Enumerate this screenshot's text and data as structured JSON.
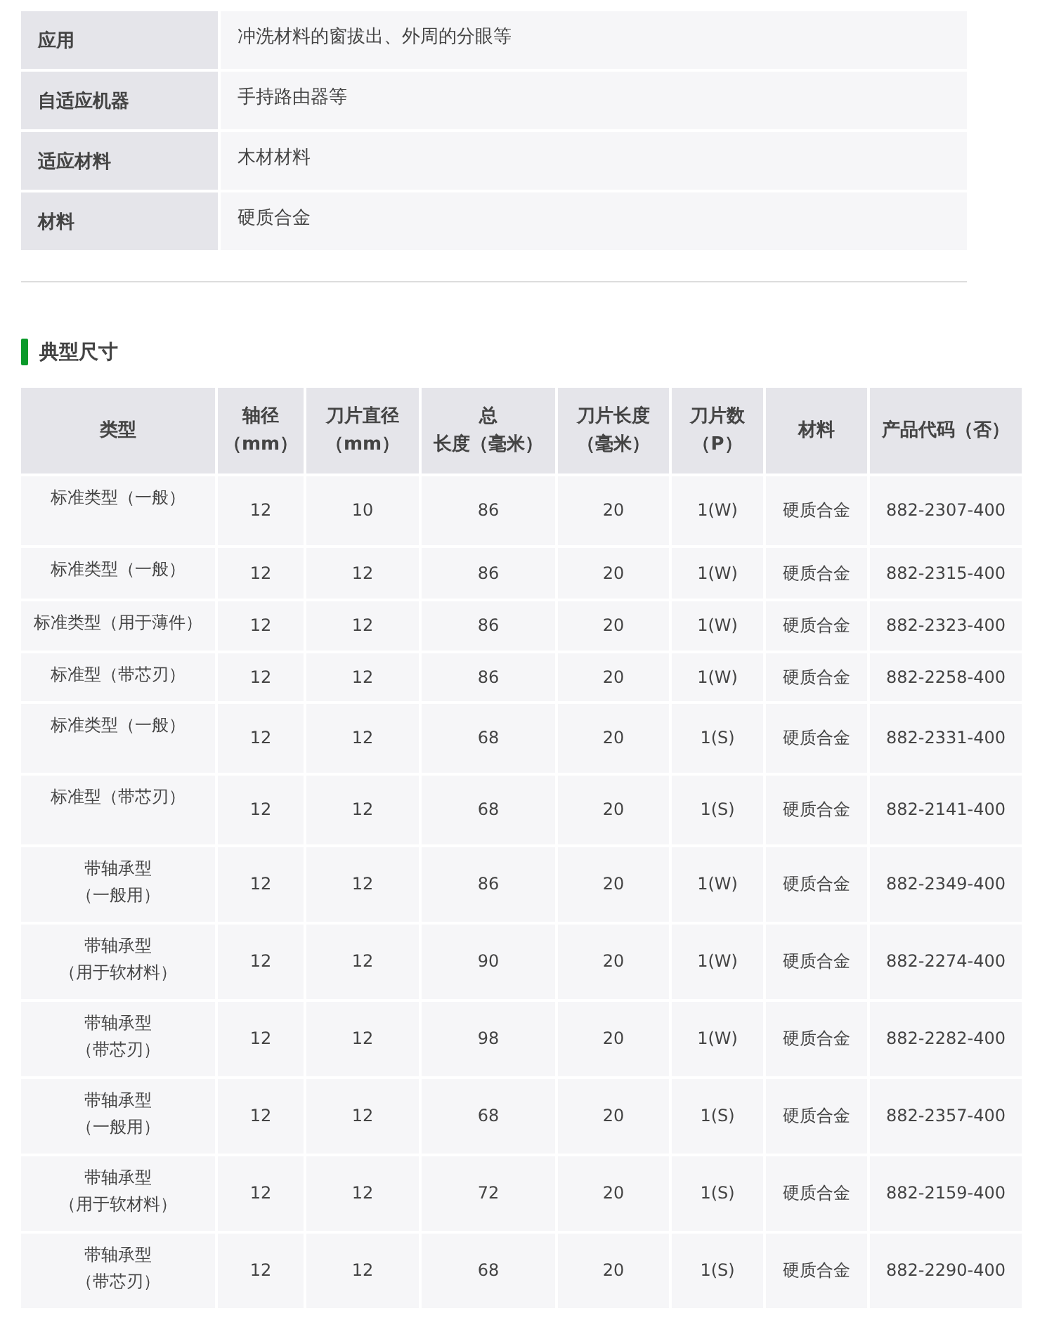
{
  "spec_table": [
    {
      "label": "应用",
      "value": "冲洗材料的窗拔出、外周的分眼等"
    },
    {
      "label": "自适应机器",
      "value": "手持路由器等"
    },
    {
      "label": "适应材料",
      "value": "木材材料"
    },
    {
      "label": "材料",
      "value": "硬质合金"
    }
  ],
  "section": {
    "title": "典型尺寸"
  },
  "table": {
    "columns": [
      "类型",
      "轴径（mm）",
      "刀片直径（mm）",
      "总长度（毫米）",
      "刀片长度（毫米）",
      "刀片数（P）",
      "材料",
      "产品代码（否）"
    ],
    "rows": [
      [
        "标准类型（一般）",
        "12",
        "10",
        "86",
        "20",
        "1(W)",
        "硬质合金",
        "882-2307-400"
      ],
      [
        "标准类型（一般）",
        "12",
        "12",
        "86",
        "20",
        "1(W)",
        "硬质合金",
        "882-2315-400"
      ],
      [
        "标准类型（用于薄件）",
        "12",
        "12",
        "86",
        "20",
        "1(W)",
        "硬质合金",
        "882-2323-400"
      ],
      [
        "标准型（带芯刃）",
        "12",
        "12",
        "86",
        "20",
        "1(W)",
        "硬质合金",
        "882-2258-400"
      ],
      [
        "标准类型（一般）",
        "12",
        "12",
        "68",
        "20",
        "1(S)",
        "硬质合金",
        "882-2331-400"
      ],
      [
        "标准型（带芯刃）",
        "12",
        "12",
        "68",
        "20",
        "1(S)",
        "硬质合金",
        "882-2141-400"
      ],
      [
        "带轴承型（一般用）",
        "12",
        "12",
        "86",
        "20",
        "1(W)",
        "硬质合金",
        "882-2349-400"
      ],
      [
        "带轴承型（用于软材料）",
        "12",
        "12",
        "90",
        "20",
        "1(W)",
        "硬质合金",
        "882-2274-400"
      ],
      [
        "带轴承型（带芯刃）",
        "12",
        "12",
        "98",
        "20",
        "1(W)",
        "硬质合金",
        "882-2282-400"
      ],
      [
        "带轴承型（一般用）",
        "12",
        "12",
        "68",
        "20",
        "1(S)",
        "硬质合金",
        "882-2357-400"
      ],
      [
        "带轴承型（用于软材料）",
        "12",
        "12",
        "72",
        "20",
        "1(S)",
        "硬质合金",
        "882-2159-400"
      ],
      [
        "带轴承型（带芯刃）",
        "12",
        "12",
        "68",
        "20",
        "1(S)",
        "硬质合金",
        "882-2290-400"
      ]
    ]
  }
}
